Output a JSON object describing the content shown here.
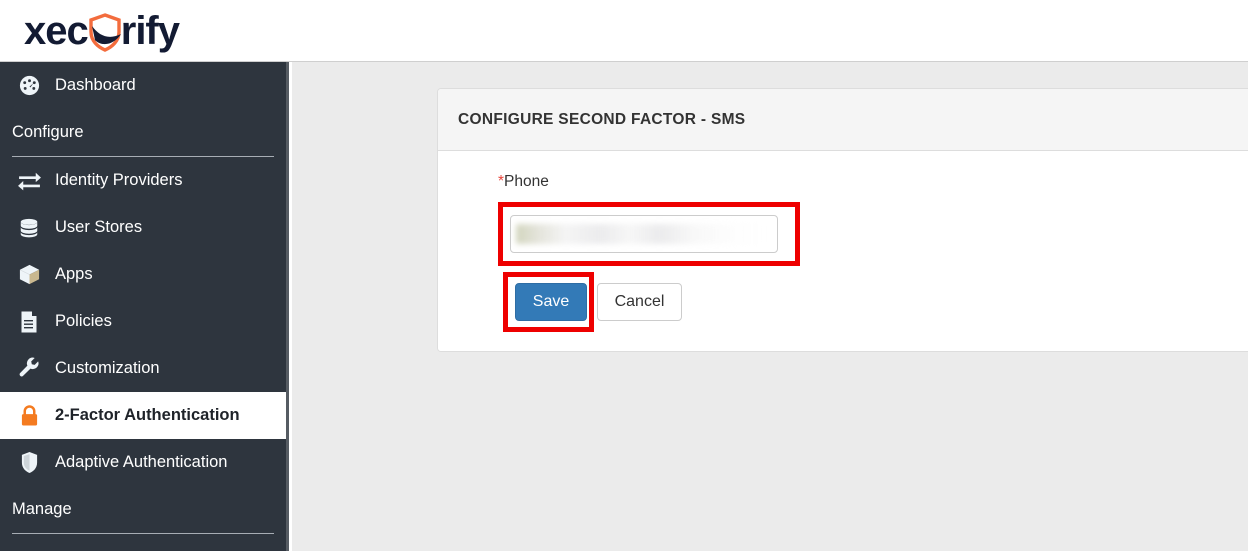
{
  "brand": {
    "name_part1": "xec",
    "name_part2": "rify",
    "logo_icon": "shield-check-icon",
    "accent_color": "#f36c3d",
    "text_color": "#131b33"
  },
  "sidebar": {
    "background_color": "#2e353e",
    "active_item_background": "#ffffff",
    "items": [
      {
        "label": "Dashboard",
        "icon": "dashboard-gauge-icon",
        "type": "link",
        "active": false
      },
      {
        "label": "Configure",
        "icon": "",
        "type": "section",
        "active": false
      },
      {
        "label": "Identity Providers",
        "icon": "exchange-arrows-icon",
        "type": "link",
        "active": false
      },
      {
        "label": "User Stores",
        "icon": "database-icon",
        "type": "link",
        "active": false
      },
      {
        "label": "Apps",
        "icon": "cube-icon",
        "type": "link",
        "active": false
      },
      {
        "label": "Policies",
        "icon": "document-icon",
        "type": "link",
        "active": false
      },
      {
        "label": "Customization",
        "icon": "wrench-icon",
        "type": "link",
        "active": false
      },
      {
        "label": "2-Factor Authentication",
        "icon": "lock-icon",
        "type": "link",
        "active": true
      },
      {
        "label": "Adaptive Authentication",
        "icon": "shield-icon",
        "type": "link",
        "active": false
      },
      {
        "label": "Manage",
        "icon": "",
        "type": "section",
        "active": false
      }
    ]
  },
  "card": {
    "title": "CONFIGURE SECOND FACTOR - SMS",
    "form": {
      "phone_label": "Phone",
      "phone_required_marker": "*",
      "phone_value": "",
      "phone_placeholder": "",
      "phone_redacted": true
    },
    "actions": {
      "save_label": "Save",
      "cancel_label": "Cancel",
      "save_color": "#337ab7"
    }
  },
  "annotations": {
    "highlight_color": "#ee0000",
    "boxes": [
      {
        "target": "phone-input",
        "label": ""
      },
      {
        "target": "save-button",
        "label": ""
      }
    ]
  }
}
